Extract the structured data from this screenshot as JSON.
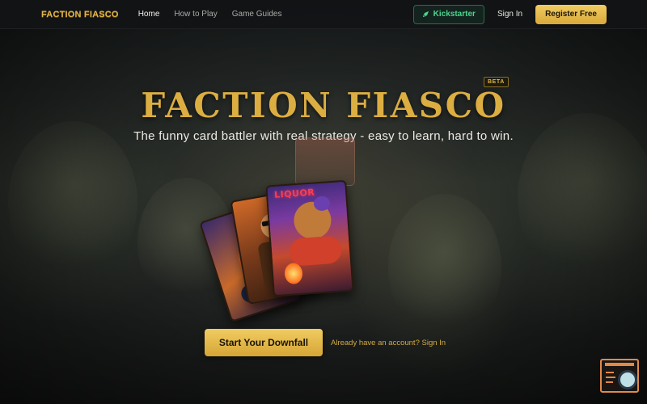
{
  "nav": {
    "brand": "FACTION FIASCO",
    "links": [
      {
        "label": "Home",
        "active": true
      },
      {
        "label": "How to Play",
        "active": false
      },
      {
        "label": "Game Guides",
        "active": false
      }
    ],
    "kickstarter_label": "Kickstarter",
    "signin_label": "Sign In",
    "register_label": "Register Free"
  },
  "hero": {
    "badge": "BETA",
    "title": "FACTION FIASCO",
    "subtitle": "The funny card battler with real strategy - easy to learn, hard to win.",
    "card_text": "LIQUOR",
    "cta_label": "Start Your Downfall",
    "secondary_link": "Already have an account? Sign In"
  },
  "colors": {
    "accent_gold": "#dcae42",
    "kickstarter_green": "#4fd38f",
    "background": "#16181b"
  },
  "icons": {
    "kickstarter": "rocket-icon",
    "corner_widget": "chat-search-icon"
  }
}
